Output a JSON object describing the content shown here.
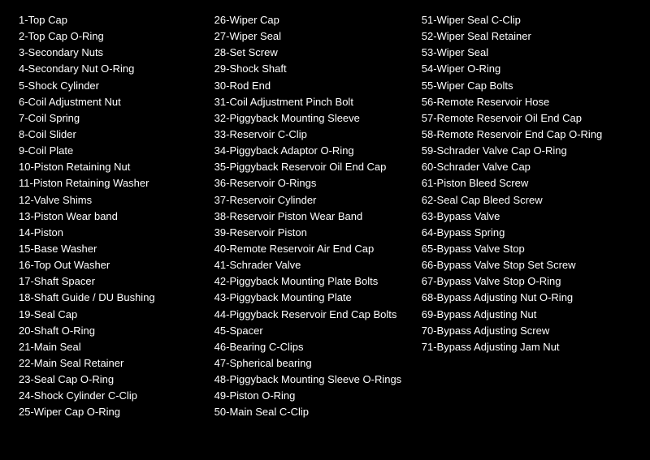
{
  "columns": [
    {
      "id": "col1",
      "items": [
        "1-Top Cap",
        "2-Top Cap O-Ring",
        "3-Secondary Nuts",
        "4-Secondary Nut O-Ring",
        "5-Shock Cylinder",
        "6-Coil Adjustment Nut",
        "7-Coil Spring",
        "8-Coil Slider",
        "9-Coil Plate",
        "10-Piston Retaining Nut",
        "11-Piston Retaining Washer",
        "12-Valve Shims",
        "13-Piston Wear band",
        "14-Piston",
        "15-Base Washer",
        "16-Top Out Washer",
        "17-Shaft Spacer",
        "18-Shaft Guide / DU Bushing",
        "19-Seal Cap",
        "20-Shaft O-Ring",
        "21-Main Seal",
        "22-Main Seal Retainer",
        "23-Seal Cap O-Ring",
        "24-Shock Cylinder C-Clip",
        "25-Wiper Cap O-Ring"
      ]
    },
    {
      "id": "col2",
      "items": [
        "26-Wiper Cap",
        "27-Wiper Seal",
        "28-Set Screw",
        "29-Shock Shaft",
        "30-Rod End",
        "31-Coil Adjustment Pinch Bolt",
        "32-Piggyback Mounting Sleeve",
        "33-Reservoir C-Clip",
        "34-Piggyback Adaptor O-Ring",
        "35-Piggyback Reservoir Oil End Cap",
        "36-Reservoir O-Rings",
        "37-Reservoir Cylinder",
        "38-Reservoir Piston Wear Band",
        "39-Reservoir Piston",
        "40-Remote Reservoir Air End Cap",
        "41-Schrader Valve",
        "42-Piggyback Mounting Plate Bolts",
        "43-Piggyback Mounting Plate",
        "44-Piggyback Reservoir End Cap Bolts",
        "45-Spacer",
        "46-Bearing C-Clips",
        "47-Spherical bearing",
        "48-Piggyback Mounting Sleeve O-Rings",
        "49-Piston O-Ring",
        "50-Main Seal C-Clip"
      ]
    },
    {
      "id": "col3",
      "items": [
        "51-Wiper Seal C-Clip",
        "52-Wiper Seal Retainer",
        "53-Wiper Seal",
        "54-Wiper O-Ring",
        "55-Wiper Cap Bolts",
        "56-Remote Reservoir Hose",
        "57-Remote Reservoir Oil End Cap",
        "58-Remote Reservoir End Cap O-Ring",
        "59-Schrader Valve Cap O-Ring",
        "60-Schrader Valve Cap",
        "61-Piston Bleed Screw",
        "62-Seal Cap Bleed Screw",
        "63-Bypass Valve",
        "64-Bypass Spring",
        "65-Bypass Valve Stop",
        "66-Bypass Valve Stop Set Screw",
        "67-Bypass Valve Stop O-Ring",
        "68-Bypass Adjusting Nut O-Ring",
        "69-Bypass Adjusting Nut",
        "70-Bypass Adjusting Screw",
        "71-Bypass Adjusting Jam Nut"
      ]
    }
  ]
}
